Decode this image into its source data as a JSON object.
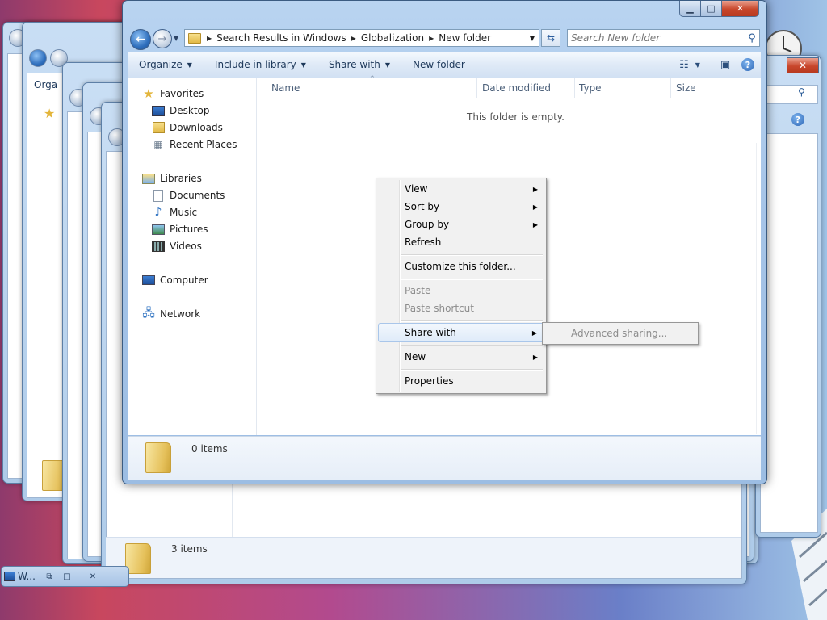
{
  "window": {
    "title_buttons": {
      "minimize": "▁",
      "maximize": "□",
      "close": "✕"
    },
    "breadcrumb": [
      "Search Results in Windows",
      "Globalization",
      "New folder"
    ],
    "search_placeholder": "Search New folder"
  },
  "toolbar": {
    "organize": "Organize",
    "include_in_library": "Include in library",
    "share_with": "Share with",
    "new_folder": "New folder"
  },
  "nav": {
    "favorites": "Favorites",
    "desktop": "Desktop",
    "downloads": "Downloads",
    "recent_places": "Recent Places",
    "libraries": "Libraries",
    "documents": "Documents",
    "music": "Music",
    "pictures": "Pictures",
    "videos": "Videos",
    "computer": "Computer",
    "network": "Network"
  },
  "columns": {
    "name": "Name",
    "date_modified": "Date modified",
    "type": "Type",
    "size": "Size"
  },
  "empty_message": "This folder is empty.",
  "details": {
    "item_count": "0 items"
  },
  "back_window": {
    "item_count": "3 items",
    "toolbar_partial": "Orga"
  },
  "context_menu": {
    "view": "View",
    "sort_by": "Sort by",
    "group_by": "Group by",
    "refresh": "Refresh",
    "customize": "Customize this folder...",
    "paste": "Paste",
    "paste_shortcut": "Paste shortcut",
    "share_with": "Share with",
    "new": "New",
    "properties": "Properties"
  },
  "submenu": {
    "advanced_sharing": "Advanced sharing..."
  },
  "taskbar_thumb": {
    "label": "W..."
  }
}
